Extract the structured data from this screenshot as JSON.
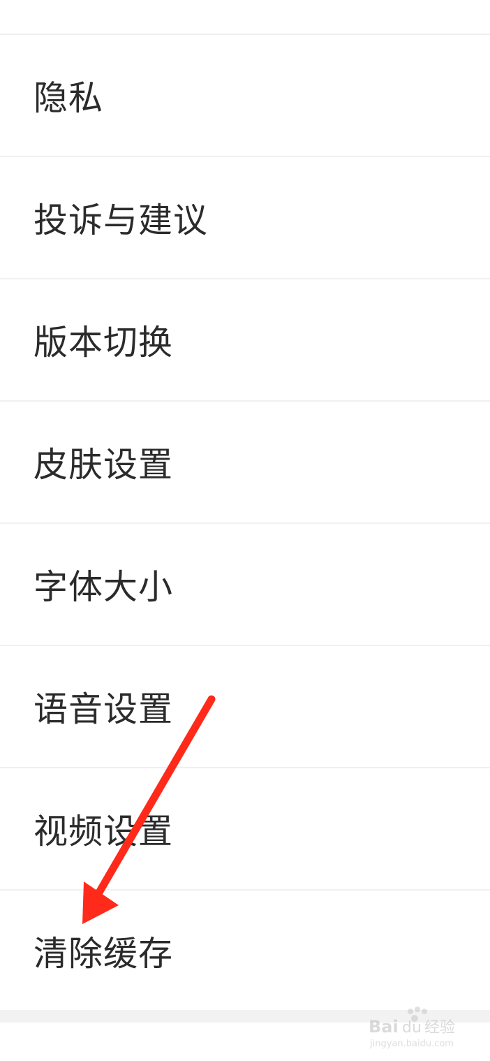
{
  "settings": {
    "items": [
      {
        "label": "隐私"
      },
      {
        "label": "投诉与建议"
      },
      {
        "label": "版本切换"
      },
      {
        "label": "皮肤设置"
      },
      {
        "label": "字体大小"
      },
      {
        "label": "语音设置"
      },
      {
        "label": "视频设置"
      },
      {
        "label": "清除缓存"
      }
    ]
  },
  "annotation": {
    "color": "#ff2a1a",
    "icon": "red-arrow-pointing-to-clear-cache"
  },
  "watermark": {
    "brand": "Baidu经验",
    "url": "jingyan.baidu.com"
  }
}
